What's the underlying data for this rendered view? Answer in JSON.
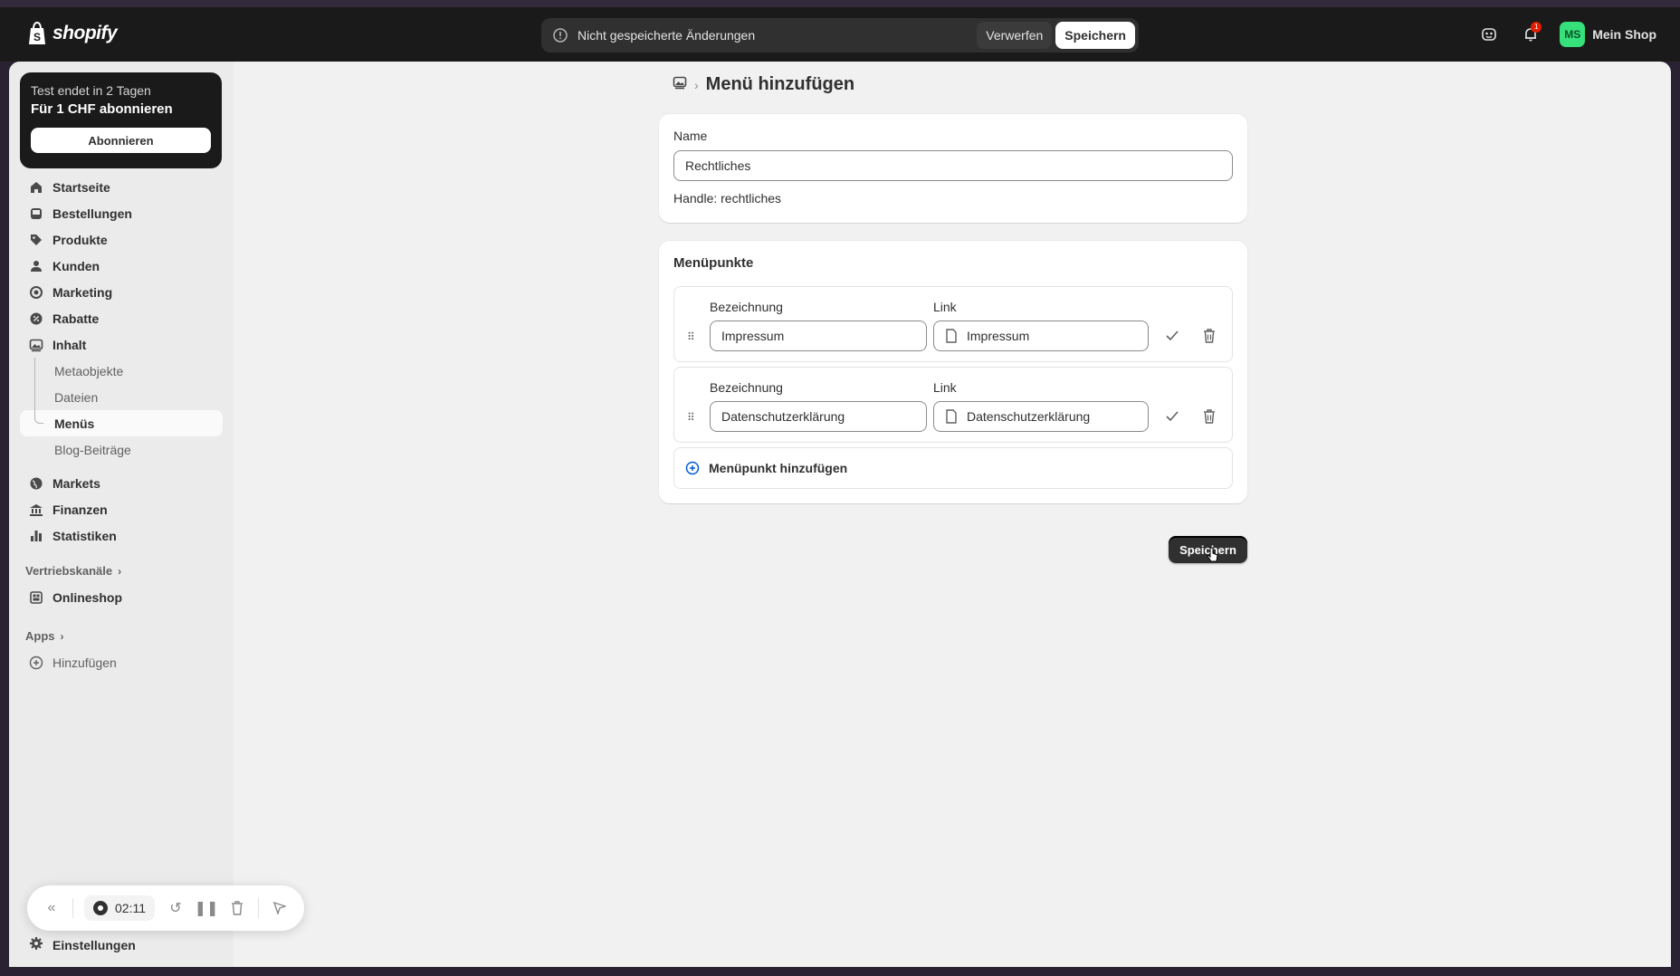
{
  "topbar": {
    "brand": "shopify",
    "unsaved_message": "Nicht gespeicherte Änderungen",
    "discard_label": "Verwerfen",
    "save_label": "Speichern",
    "notification_count": "1",
    "store_initials": "MS",
    "store_name": "Mein Shop",
    "avatar_color": "#36e07a"
  },
  "trial": {
    "line1": "Test endet in 2 Tagen",
    "line2": "Für 1 CHF abonnieren",
    "button_label": "Abonnieren"
  },
  "sidebar": {
    "items": [
      {
        "label": "Startseite",
        "icon": "home-icon"
      },
      {
        "label": "Bestellungen",
        "icon": "inbox-icon"
      },
      {
        "label": "Produkte",
        "icon": "tag-icon"
      },
      {
        "label": "Kunden",
        "icon": "person-icon"
      },
      {
        "label": "Marketing",
        "icon": "target-icon"
      },
      {
        "label": "Rabatte",
        "icon": "discount-icon"
      },
      {
        "label": "Inhalt",
        "icon": "image-icon"
      }
    ],
    "content_sub": [
      "Metaobjekte",
      "Dateien",
      "Menüs",
      "Blog-Beiträge"
    ],
    "items2": [
      {
        "label": "Markets",
        "icon": "globe-icon"
      },
      {
        "label": "Finanzen",
        "icon": "bank-icon"
      },
      {
        "label": "Statistiken",
        "icon": "chart-icon"
      }
    ],
    "sales_channels_label": "Vertriebskanäle",
    "online_store_label": "Onlineshop",
    "apps_label": "Apps",
    "add_app_label": "Hinzufügen",
    "settings_label": "Einstellungen"
  },
  "recorder": {
    "time": "02:11"
  },
  "page": {
    "title": "Menü hinzufügen",
    "name_label": "Name",
    "name_value": "Rechtliches",
    "handle_text": "Handle: rechtliches",
    "menu_items_title": "Menüpunkte",
    "menu_items": [
      {
        "label_header": "Bezeichnung",
        "link_header": "Link",
        "name": "Impressum",
        "link": "Impressum"
      },
      {
        "label_header": "Bezeichnung",
        "link_header": "Link",
        "name": "Datenschutzerklärung",
        "link": "Datenschutzerklärung"
      }
    ],
    "add_item_label": "Menüpunkt hinzufügen",
    "save_label": "Speichern"
  }
}
